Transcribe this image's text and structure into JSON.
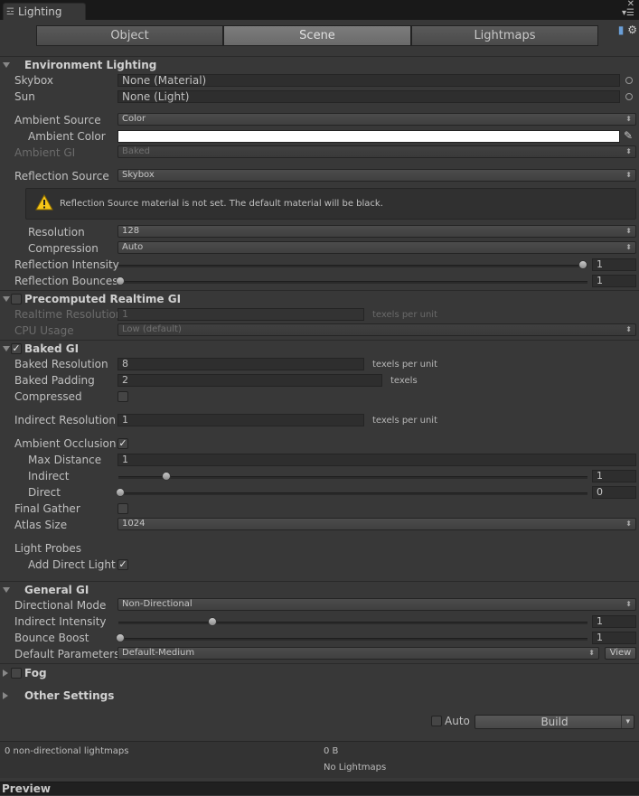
{
  "window": {
    "tab_title": "Lighting"
  },
  "tabs": [
    {
      "label": "Object"
    },
    {
      "label": "Scene"
    },
    {
      "label": "Lightmaps"
    }
  ],
  "environment": {
    "header": "Environment Lighting",
    "skybox_label": "Skybox",
    "skybox_value": "None (Material)",
    "sun_label": "Sun",
    "sun_value": "None (Light)",
    "ambient_source_label": "Ambient Source",
    "ambient_source_value": "Color",
    "ambient_color_label": "Ambient Color",
    "ambient_color": "#ffffff",
    "ambient_gi_label": "Ambient GI",
    "ambient_gi_value": "Baked",
    "reflection_source_label": "Reflection Source",
    "reflection_source_value": "Skybox",
    "warning_text": "Reflection Source material is not set. The default material will be black.",
    "resolution_label": "Resolution",
    "resolution_value": "128",
    "compression_label": "Compression",
    "compression_value": "Auto",
    "reflection_intensity_label": "Reflection Intensity",
    "reflection_intensity_value": "1",
    "reflection_bounces_label": "Reflection Bounces",
    "reflection_bounces_value": "1"
  },
  "precomputed": {
    "header": "Precomputed Realtime GI",
    "enabled": false,
    "realtime_resolution_label": "Realtime Resolution",
    "realtime_resolution_value": "1",
    "unit": "texels per unit",
    "cpu_usage_label": "CPU Usage",
    "cpu_usage_value": "Low (default)"
  },
  "baked": {
    "header": "Baked GI",
    "enabled": true,
    "baked_resolution_label": "Baked Resolution",
    "baked_resolution_value": "8",
    "baked_resolution_unit": "texels per unit",
    "baked_padding_label": "Baked Padding",
    "baked_padding_value": "2",
    "baked_padding_unit": "texels",
    "compressed_label": "Compressed",
    "indirect_resolution_label": "Indirect Resolution",
    "indirect_resolution_value": "1",
    "indirect_resolution_unit": "texels per unit",
    "ambient_occlusion_label": "Ambient Occlusion",
    "max_distance_label": "Max Distance",
    "max_distance_value": "1",
    "indirect_label": "Indirect",
    "indirect_value": "1",
    "direct_label": "Direct",
    "direct_value": "0",
    "final_gather_label": "Final Gather",
    "atlas_size_label": "Atlas Size",
    "atlas_size_value": "1024",
    "light_probes_label": "Light Probes",
    "add_direct_light_label": "Add Direct Light"
  },
  "general": {
    "header": "General GI",
    "directional_mode_label": "Directional Mode",
    "directional_mode_value": "Non-Directional",
    "indirect_intensity_label": "Indirect Intensity",
    "indirect_intensity_value": "1",
    "bounce_boost_label": "Bounce Boost",
    "bounce_boost_value": "1",
    "default_parameters_label": "Default Parameters",
    "default_parameters_value": "Default-Medium",
    "view_label": "View"
  },
  "fog": {
    "header": "Fog"
  },
  "other": {
    "header": "Other Settings"
  },
  "build": {
    "auto_label": "Auto",
    "build_label": "Build"
  },
  "stats": {
    "lightmaps": "0 non-directional lightmaps",
    "size": "0 B",
    "no_lightmaps": "No Lightmaps"
  },
  "preview": {
    "label": "Preview"
  }
}
